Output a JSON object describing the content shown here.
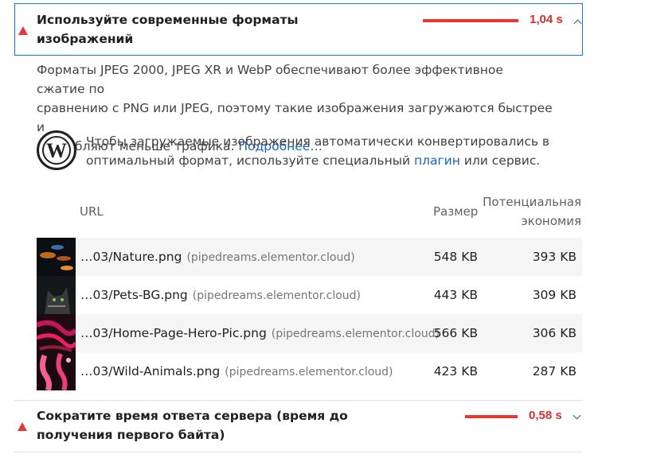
{
  "audit1": {
    "title_line1": "Используйте современные форматы",
    "title_line2": "изображений",
    "value": "1,04 s",
    "status_color": "#e53935",
    "expanded": true,
    "icon": "chevron-up-icon"
  },
  "description": {
    "line1": "Форматы JPEG 2000, JPEG XR и WebP обеспечивают более эффективное сжатие по",
    "line2": "сравнению с PNG или JPEG, поэтому такие изображения загружаются быстрее и",
    "line3": "потребляют меньше трафика.",
    "link": "Подробнее…"
  },
  "wordpress_tip": {
    "icon": "wordpress-logo-icon",
    "line1": "Чтобы загружаемые изображения автоматически конвертировались в",
    "line2_before": "оптимальный формат, используйте специальный",
    "link": "плагин",
    "line2_after": "или сервис."
  },
  "table": {
    "headers": {
      "url": "URL",
      "size": "Размер",
      "savings_line1": "Потенциальная",
      "savings_line2": "экономия"
    },
    "rows": [
      {
        "url": "…03/Nature.png",
        "host": "(pipedreams.elementor.cloud)",
        "size": "548 KB",
        "savings": "393 KB"
      },
      {
        "url": "…03/Pets-BG.png",
        "host": "(pipedreams.elementor.cloud)",
        "size": "443 KB",
        "savings": "309 KB"
      },
      {
        "url": "…03/Home-Page-Hero-Pic.png",
        "host": "(pipedreams.elementor.cloud)",
        "size": "566 KB",
        "savings": "306 KB"
      },
      {
        "url": "…03/Wild-Animals.png",
        "host": "(pipedreams.elementor.cloud)",
        "size": "423 KB",
        "savings": "287 KB"
      }
    ]
  },
  "audit2": {
    "title_line1": "Сократите время ответа сервера (время до",
    "title_line2": "получения первого байта)",
    "value": "0,58 s",
    "status_color": "#e53935",
    "expanded": false,
    "icon": "chevron-down-icon"
  }
}
